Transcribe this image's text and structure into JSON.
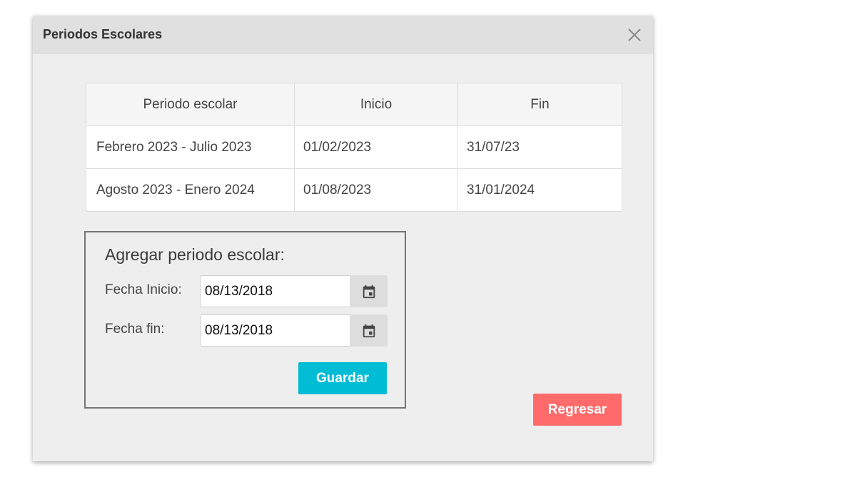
{
  "dialog": {
    "title": "Periodos Escolares",
    "close_icon": "close-icon"
  },
  "table": {
    "headers": [
      "Periodo escolar",
      "Inicio",
      "Fin"
    ],
    "rows": [
      [
        "Febrero 2023 - Julio 2023",
        "01/02/2023",
        "31/07/23"
      ],
      [
        "Agosto 2023 - Enero 2024",
        "01/08/2023",
        "31/01/2024"
      ]
    ]
  },
  "form": {
    "title": "Agregar periodo escolar:",
    "start_label": "Fecha Inicio:",
    "start_value": "08/13/2018",
    "end_label": "Fecha fin:",
    "end_value": "08/13/2018",
    "calendar_icon": "calendar-icon",
    "save_label": "Guardar"
  },
  "footer": {
    "back_label": "Regresar"
  },
  "colors": {
    "save_button": "#00bcd4",
    "back_button": "#ff6b6b",
    "header_bg": "#e0e0e0",
    "dialog_bg": "#eeeeee"
  }
}
